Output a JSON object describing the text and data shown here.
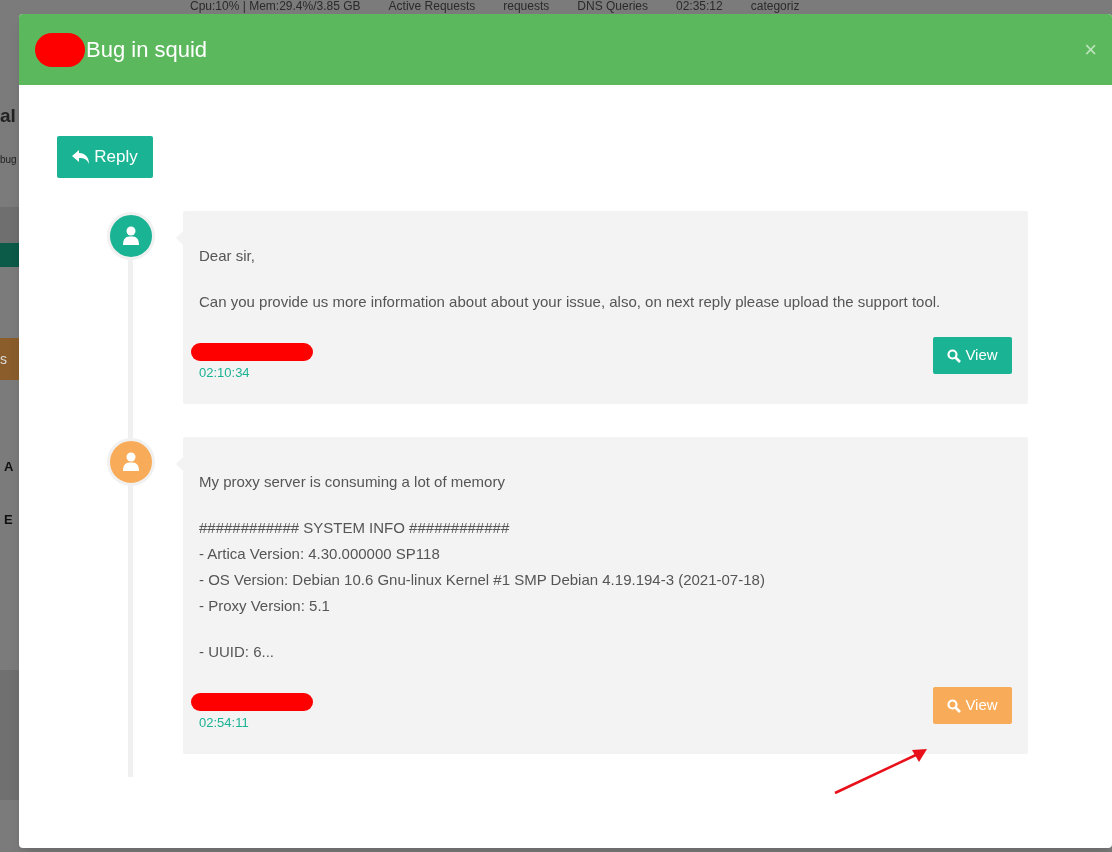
{
  "background": {
    "status_items": [
      "Cpu:10% | Mem:29.4%/3.85 GB",
      "Active Requests",
      "requests",
      "DNS Queries",
      "02:35:12",
      "categoriz"
    ],
    "heading_fragment": "al",
    "subtitle_fragment": "bug",
    "button_fragment": "s",
    "row_fragments": [
      "A",
      "E"
    ]
  },
  "modal": {
    "title": "Bug in squid",
    "close": "×",
    "reply_button": "Reply",
    "messages": [
      {
        "color": "#1ab394",
        "paragraphs": [
          [
            "Dear sir,"
          ],
          [
            "Can you provide us more information about about your issue, also, on next reply please upload the support tool."
          ]
        ],
        "time": "02:10:34",
        "view_button": "View"
      },
      {
        "color": "#f8ac59",
        "paragraphs": [
          [
            "My proxy server is consuming a lot of memory"
          ],
          [
            "############ SYSTEM INFO ############",
            "- Artica Version: 4.30.000000 SP118",
            "- OS Version: Debian 10.6 Gnu-linux Kernel #1 SMP Debian 4.19.194-3 (2021-07-18)",
            "- Proxy Version: 5.1"
          ],
          [
            "- UUID: 6..."
          ]
        ],
        "time": "02:54:11",
        "view_button": "View"
      }
    ]
  }
}
